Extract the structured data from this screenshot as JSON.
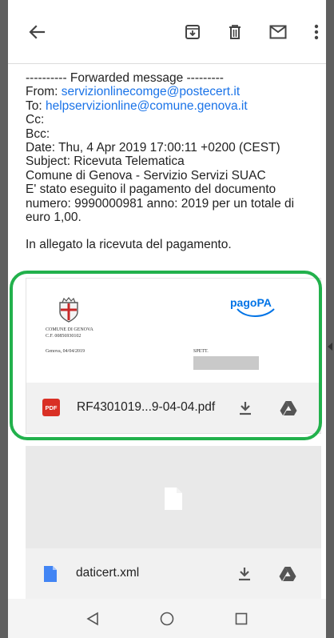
{
  "email": {
    "forwarded_header": "---------- Forwarded message ---------",
    "from_label": "From:",
    "from_value": "servizionlinecomge@postecert.it",
    "to_label": "To:",
    "to_value": "helpservizionline@comune.genova.it",
    "cc": "Cc:",
    "bcc": "Bcc:",
    "date": "Date: Thu, 4 Apr 2019 17:00:11 +0200 (CEST)",
    "subject": "Subject: Ricevuta Telematica",
    "line_comune": "Comune di Genova - Servizio Servizi SUAC",
    "body_paragraph": "E' stato eseguito il pagamento del documento numero: 9990000981 anno: 2019 per un totale di euro 1,00.",
    "body_attachment_note": "In allegato la ricevuta del pagamento."
  },
  "attachments": [
    {
      "file_name": "RF4301019...9-04-04.pdf",
      "type_badge": "PDF",
      "preview": {
        "org_line1": "COMUNE DI GENOVA",
        "org_line2": "C.F. 00856930102",
        "place_date": "Genova, 04/04/2019",
        "recipient_label": "SPETT.",
        "logo_text": "pagoPA"
      }
    },
    {
      "file_name": "daticert.xml"
    }
  ],
  "colors": {
    "highlight": "#22b14c",
    "link": "#1a73e8",
    "pdf_badge": "#d93025",
    "file_icon": "#4285f4",
    "pagopa": "#0073e6"
  }
}
